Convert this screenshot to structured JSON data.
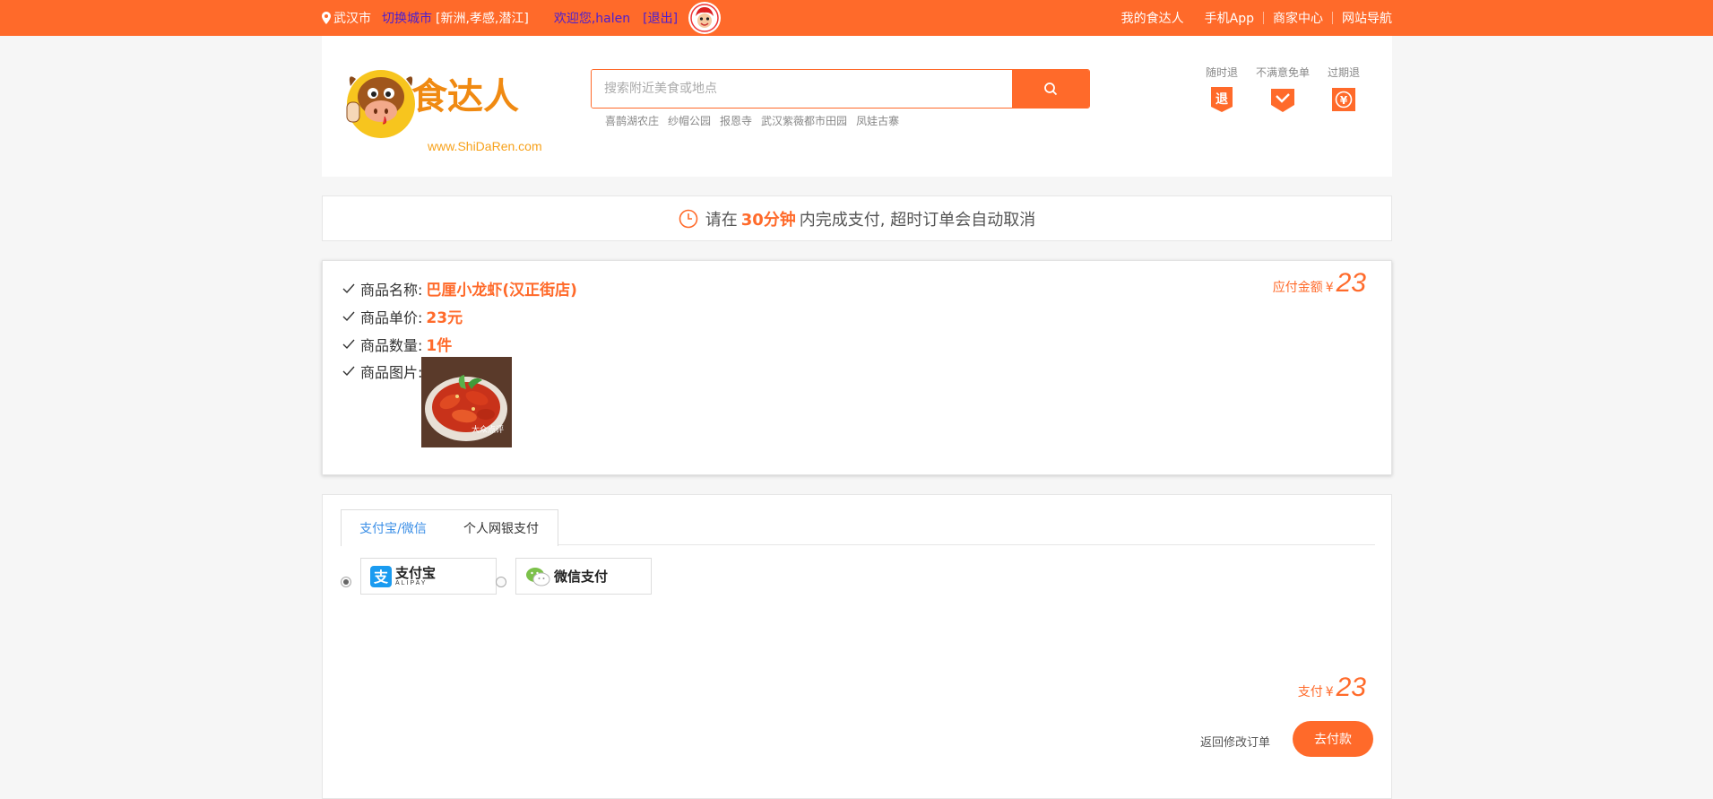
{
  "topbar": {
    "city": "武汉市",
    "switch_city": "切换城市",
    "nearby": "[新洲,孝感,潜江]",
    "welcome": "欢迎您,halen",
    "logout": "[退出]",
    "right_links": [
      "我的食达人",
      "手机App",
      "商家中心",
      "网站导航"
    ],
    "bg_color": "#ff6a2a"
  },
  "header": {
    "logo_text": "食达人",
    "logo_url": "www.ShiDaRen.com",
    "search_placeholder": "搜索附近美食或地点",
    "hot_links": [
      "喜鹊湖农庄",
      "纱帽公园",
      "报恩寺",
      "武汉紫薇都市田园",
      "凤娃古寨"
    ],
    "guarantees": [
      {
        "label": "随时退",
        "icon": "refund-icon"
      },
      {
        "label": "不满意免单",
        "icon": "envelope-check-icon"
      },
      {
        "label": "过期退",
        "icon": "yuan-icon"
      }
    ]
  },
  "timer": {
    "prefix": "请在",
    "time": "30分钟",
    "suffix": "内完成支付, 超时订单会自动取消"
  },
  "order": {
    "name_label": "商品名称:",
    "name_value": "巴厘小龙虾(汉正街店)",
    "price_label": "商品单价:",
    "price_value": "23元",
    "qty_label": "商品数量:",
    "qty_value": "1件",
    "image_label": "商品图片:",
    "amount_label": "应付金额",
    "currency": "¥",
    "amount": "23",
    "image_watermark": "大众点评"
  },
  "payment": {
    "tabs": [
      "支付宝/微信",
      "个人网银支付"
    ],
    "options": [
      {
        "name": "支付宝",
        "sub": "ALIPAY",
        "selected": true
      },
      {
        "name": "微信支付",
        "selected": false
      }
    ],
    "total_label": "支付",
    "currency": "¥",
    "total": "23",
    "back_label": "返回修改订单",
    "pay_button": "去付款"
  }
}
